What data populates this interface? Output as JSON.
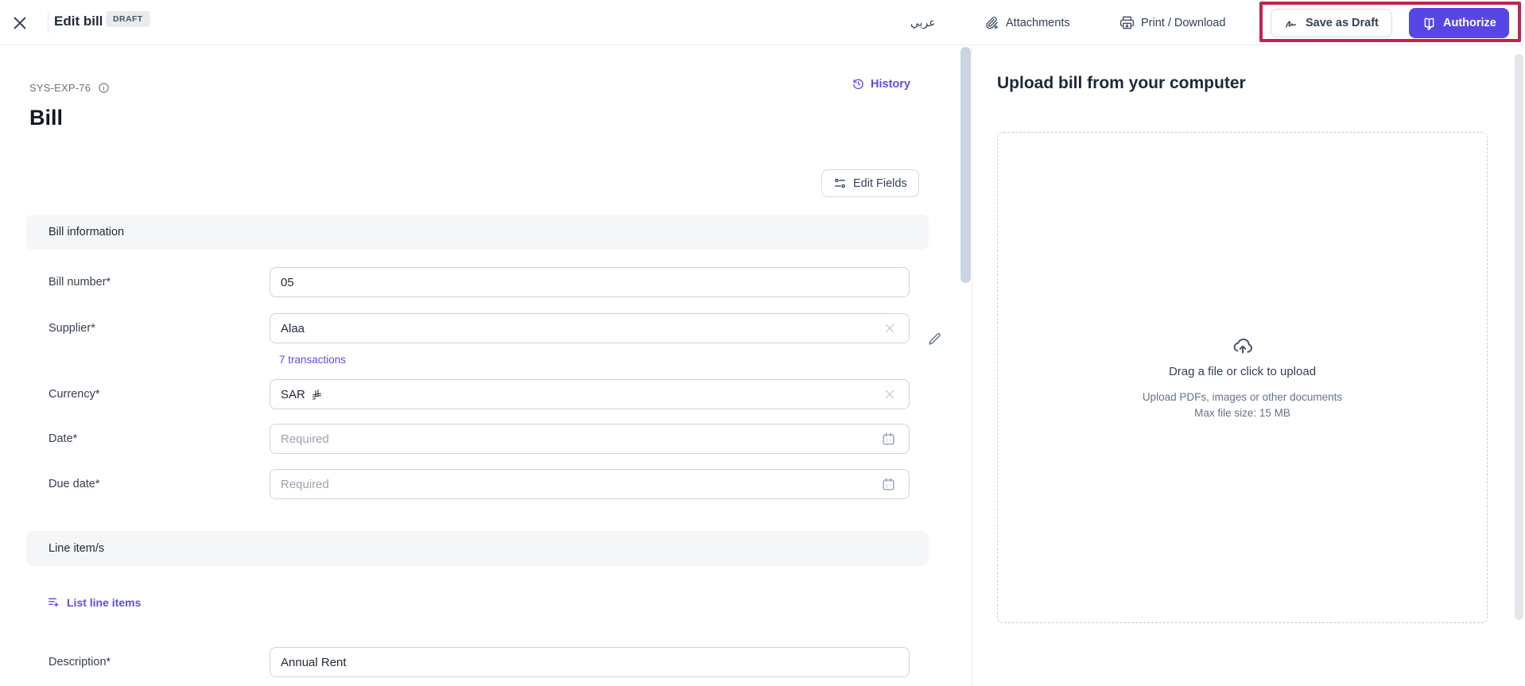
{
  "header": {
    "title": "Edit bill",
    "status_badge": "DRAFT",
    "language_toggle": "عربي",
    "attachments_label": "Attachments",
    "print_label": "Print / Download",
    "save_draft_label": "Save as Draft",
    "authorize_label": "Authorize"
  },
  "form": {
    "doc_id": "SYS-EXP-76",
    "history_label": "History",
    "page_title": "Bill",
    "edit_fields_label": "Edit Fields",
    "sections": {
      "bill_information": "Bill information",
      "line_items": "Line item/s"
    },
    "fields": {
      "bill_number": {
        "label": "Bill number*",
        "value": "05"
      },
      "supplier": {
        "label": "Supplier*",
        "value": "Alaa",
        "link": "7 transactions"
      },
      "currency": {
        "label": "Currency*",
        "value": "SAR"
      },
      "date": {
        "label": "Date*",
        "placeholder": "Required"
      },
      "due_date": {
        "label": "Due date*",
        "placeholder": "Required"
      },
      "description": {
        "label": "Description*",
        "value": "Annual Rent"
      }
    },
    "list_line_items_label": "List line items"
  },
  "upload_panel": {
    "title": "Upload bill from your computer",
    "drag_text": "Drag a file or click to upload",
    "hint_line1": "Upload PDFs, images or other documents",
    "hint_line2": "Max file size: 15 MB"
  },
  "colors": {
    "accent_purple": "#5746e5",
    "link_purple": "#5b4ff0",
    "annotation_red": "#c2244b"
  }
}
